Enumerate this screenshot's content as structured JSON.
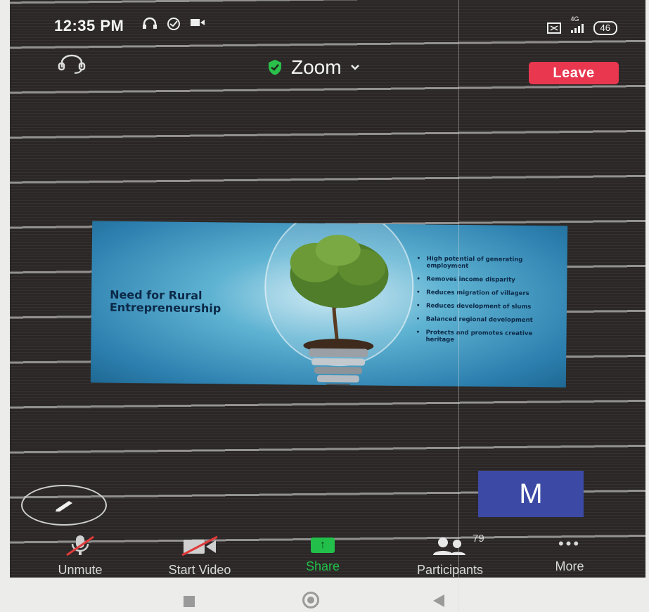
{
  "status_bar": {
    "time": "12:35 PM",
    "network": "4G",
    "battery": "46"
  },
  "topbar": {
    "app_title": "Zoom",
    "leave_label": "Leave",
    "security_color": "#2bbf4b",
    "leave_color": "#e8374f"
  },
  "slide": {
    "title": "Need for Rural Entrepreneurship",
    "bullets": [
      "High potential of generating employment",
      "Removes income disparity",
      "Reduces migration of villagers",
      "Reduces development of slums",
      "Balanced regional development",
      "Protects and promotes creative heritage"
    ]
  },
  "avatar": {
    "initial": "M",
    "color": "#3c4aa6"
  },
  "toolbar": {
    "unmute_label": "Unmute",
    "video_label": "Start Video",
    "share_label": "Share",
    "participants_label": "Participants",
    "participants_count": "79",
    "more_label": "More",
    "share_color": "#22c04a"
  },
  "icons": {
    "headset": "headset-icon",
    "shield": "shield-check-icon",
    "chevron": "chevron-down-icon",
    "pencil": "pencil-icon",
    "mic_muted": "mic-muted-icon",
    "video_off": "video-off-icon",
    "share": "share-arrow-icon",
    "participants": "people-icon",
    "more": "more-dots-icon"
  }
}
